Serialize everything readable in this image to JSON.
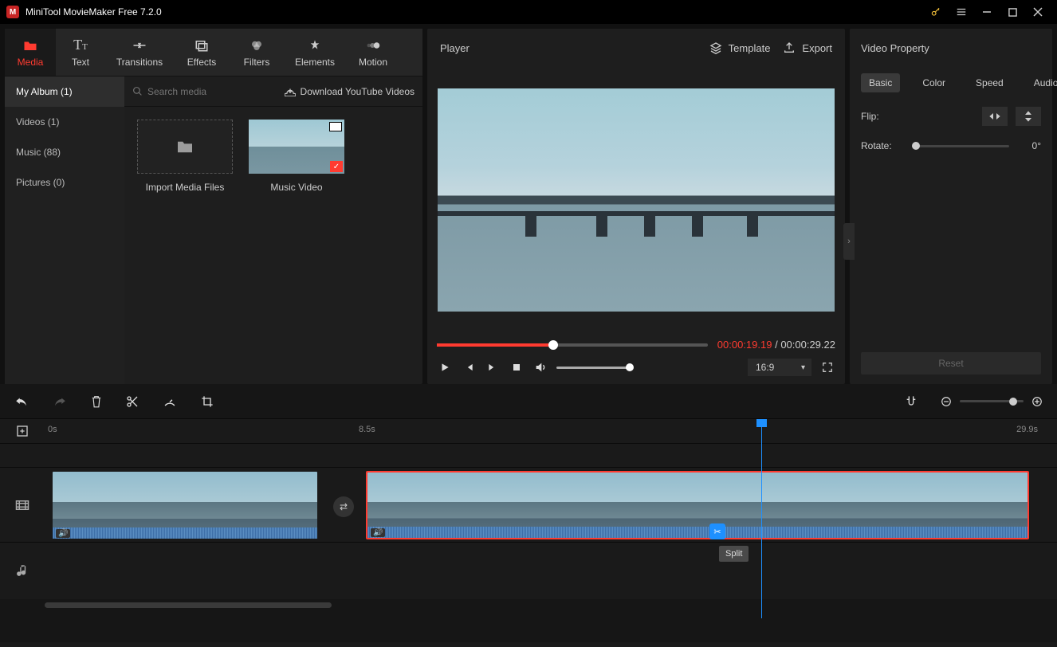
{
  "title": "MiniTool MovieMaker Free 7.2.0",
  "toolbar": {
    "media": "Media",
    "text": "Text",
    "transitions": "Transitions",
    "effects": "Effects",
    "filters": "Filters",
    "elements": "Elements",
    "motion": "Motion"
  },
  "album": {
    "my_album": "My Album (1)",
    "videos": "Videos (1)",
    "music": "Music (88)",
    "pictures": "Pictures (0)",
    "search_placeholder": "Search media",
    "download_yt": "Download YouTube Videos",
    "import_label": "Import Media Files",
    "clip1_label": "Music Video"
  },
  "player": {
    "header": "Player",
    "template": "Template",
    "export": "Export",
    "tc_current": "00:00:19.19",
    "tc_sep": " / ",
    "tc_duration": "00:00:29.22",
    "aspect": "16:9"
  },
  "props": {
    "header": "Video Property",
    "tab_basic": "Basic",
    "tab_color": "Color",
    "tab_speed": "Speed",
    "tab_audio": "Audio",
    "flip_label": "Flip:",
    "rotate_label": "Rotate:",
    "rotate_value": "0°",
    "reset": "Reset"
  },
  "timeline": {
    "ruler_0": "0s",
    "ruler_mid": "8.5s",
    "ruler_end": "29.9s",
    "split_tip": "Split"
  }
}
